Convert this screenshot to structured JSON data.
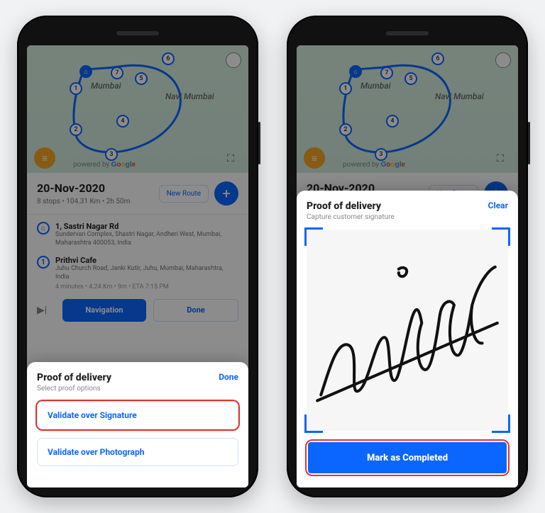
{
  "map": {
    "city1": "Mumbai",
    "city2": "Navi Mumbai",
    "attribution_prefix": "powered by",
    "attribution_brand": "Google",
    "stops": [
      "1",
      "2",
      "3",
      "4",
      "5",
      "6",
      "7"
    ]
  },
  "route": {
    "date": "20-Nov-2020",
    "meta": "8 stops • 104.31 Km • 2h 50m",
    "new_route_label": "New Route"
  },
  "stops": [
    {
      "pin": "⌂",
      "title": "1, Sastri Nagar Rd",
      "addr": "Sundervan Complex, Shastri Nagar, Andheri West, Mumbai, Maharashtra 400053, India"
    },
    {
      "pin": "1",
      "title": "Prithvi Cafe",
      "addr": "Juhu Church Road, Janki Kutir, Juhu, Mumbai, Maharashtra, India",
      "eta": "4 minutes • 4.24 Km • 9m • ETA 7:15 PM"
    }
  ],
  "actions": {
    "navigation": "Navigation",
    "done": "Done"
  },
  "sheet_left": {
    "title": "Proof of delivery",
    "subtitle": "Select proof options",
    "done": "Done",
    "option_signature": "Validate over Signature",
    "option_photo": "Validate over Photograph"
  },
  "sheet_right": {
    "title": "Proof of delivery",
    "subtitle": "Capture customer signature",
    "clear": "Clear",
    "complete": "Mark as Completed"
  }
}
